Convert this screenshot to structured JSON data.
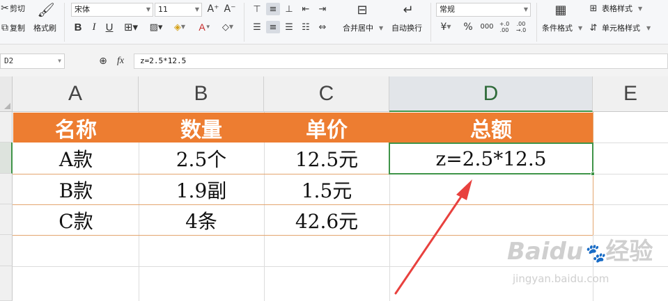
{
  "ribbon": {
    "cut_label": "剪切",
    "copy_label": "复制",
    "format_painter_label": "格式刷",
    "font_name": "宋体",
    "font_size": "11",
    "merge_center_label": "合并居中",
    "wrap_text_label": "自动换行",
    "number_format": "常规",
    "conditional_format_label": "条件格式",
    "table_style_label": "表格样式",
    "cell_style_label": "单元格样式",
    "bold_glyph": "B",
    "italic_glyph": "I",
    "underline_glyph": "U",
    "increase_font_glyph": "A⁺",
    "decrease_font_glyph": "A⁻",
    "currency_glyph": "¥",
    "percent_glyph": "%",
    "thousands_glyph": "000",
    "inc_decimal_glyph": "+.0 .00",
    "dec_decimal_glyph": ".00 →.0"
  },
  "formula_bar": {
    "cell_ref": "D2",
    "fx_label": "fx",
    "formula": "z=2.5*12.5"
  },
  "columns": [
    "A",
    "B",
    "C",
    "D",
    "E"
  ],
  "table": {
    "headers": [
      "名称",
      "数量",
      "单价",
      "总额"
    ],
    "rows": [
      [
        "A款",
        "2.5个",
        "12.5元",
        "z=2.5*12.5"
      ],
      [
        "B款",
        "1.9副",
        "1.5元",
        ""
      ],
      [
        "C款",
        "4条",
        "42.6元",
        ""
      ]
    ]
  },
  "colors": {
    "header_fill": "#ed7d31",
    "selection": "#3f9448",
    "arrow": "#e8413e"
  },
  "watermark": {
    "brand": "Baidu",
    "brand_cn": "经验",
    "url": "jingyan.baidu.com"
  }
}
